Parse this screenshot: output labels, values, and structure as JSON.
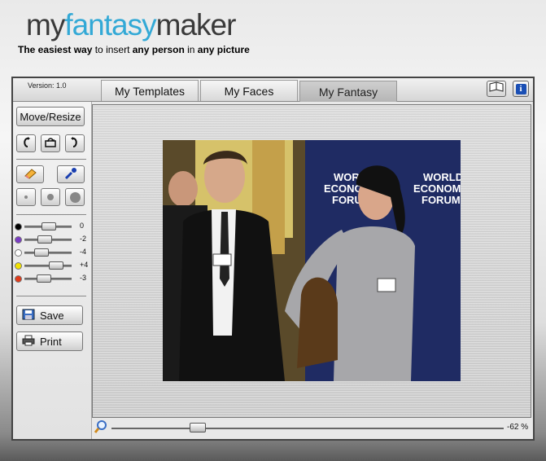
{
  "brand": {
    "logo_part1": "my",
    "logo_part2": "fantasy",
    "logo_part3": "maker",
    "tagline": [
      {
        "text": "The ",
        "bold": true
      },
      {
        "text": "easiest way",
        "bold": true,
        "accent": true
      },
      {
        "text": " to insert ",
        "bold": false
      },
      {
        "text": "any person",
        "bold": true
      },
      {
        "text": " in ",
        "bold": false
      },
      {
        "text": "any picture",
        "bold": true
      }
    ]
  },
  "header": {
    "version": "Version: 1.0",
    "tabs": [
      {
        "label": "My Templates",
        "active": false
      },
      {
        "label": "My Faces",
        "active": false
      },
      {
        "label": "My Fantasy",
        "active": true
      }
    ],
    "help_icon": "book-icon",
    "info_icon": "info-icon",
    "info_label": "i"
  },
  "sidebar": {
    "move_resize": "Move/Resize",
    "rotate_left_icon": "rotate-left-icon",
    "reset_icon": "reset-icon",
    "rotate_right_icon": "rotate-right-icon",
    "eraser_icon": "eraser-icon",
    "eyedropper_icon": "eyedropper-icon",
    "brush_sizes": [
      "small",
      "medium",
      "large"
    ],
    "adjustments": [
      {
        "name": "brightness",
        "value": "0",
        "level": 0.5,
        "color": "#000000"
      },
      {
        "name": "color",
        "value": "-2",
        "level": 0.38,
        "color": "#7a3cc4"
      },
      {
        "name": "white",
        "value": "-4",
        "level": 0.28,
        "color": "#ffffff"
      },
      {
        "name": "yellow",
        "value": "+4",
        "level": 0.72,
        "color": "#f2e200"
      },
      {
        "name": "red",
        "value": "-3",
        "level": 0.35,
        "color": "#e03a1a"
      }
    ],
    "save_label": "Save",
    "print_label": "Print"
  },
  "canvas": {
    "photo_banner_lines": [
      "WORLD",
      "ECONOMIC",
      "FORUM"
    ]
  },
  "zoom": {
    "icon": "magnifier-icon",
    "value_label": "-62 %",
    "level": 0.2
  }
}
